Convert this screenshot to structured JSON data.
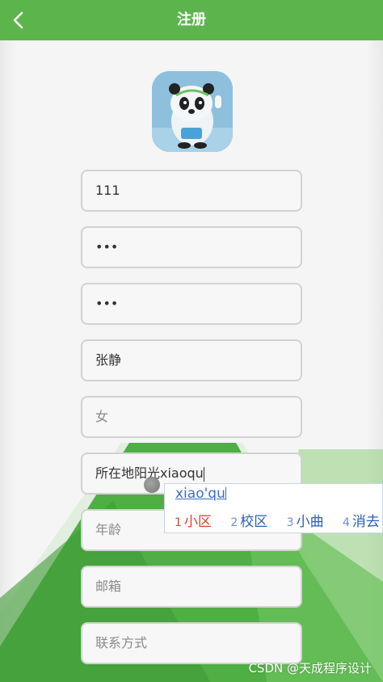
{
  "header": {
    "title": "注册",
    "back_icon": "chevron-left-icon"
  },
  "avatar": {
    "description_icon": "panda-mascot-avatar"
  },
  "form": {
    "fields": [
      {
        "name": "username",
        "value": "111",
        "placeholder": ""
      },
      {
        "name": "password",
        "value": "•••",
        "placeholder": ""
      },
      {
        "name": "confirm-password",
        "value": "•••",
        "placeholder": ""
      },
      {
        "name": "real-name",
        "value": "张静",
        "placeholder": ""
      },
      {
        "name": "gender",
        "value": "",
        "placeholder": "女"
      },
      {
        "name": "address",
        "value": "所在地阳光xiaoqu",
        "placeholder": ""
      },
      {
        "name": "age",
        "value": "",
        "placeholder": "年龄"
      },
      {
        "name": "email",
        "value": "",
        "placeholder": "邮箱"
      },
      {
        "name": "contact",
        "value": "",
        "placeholder": "联系方式"
      }
    ]
  },
  "ime": {
    "composition": "xiao'qu",
    "candidates": [
      {
        "num": "1",
        "text": "小区"
      },
      {
        "num": "2",
        "text": "校区"
      },
      {
        "num": "3",
        "text": "小曲"
      },
      {
        "num": "4",
        "text": "消去"
      }
    ]
  },
  "watermark": "CSDN @天成程序设计",
  "colors": {
    "header_green": "#5cb54c",
    "art_green": "#4fae44",
    "ime_blue": "#2a5fb8",
    "ime_selected_red": "#d9422c"
  }
}
